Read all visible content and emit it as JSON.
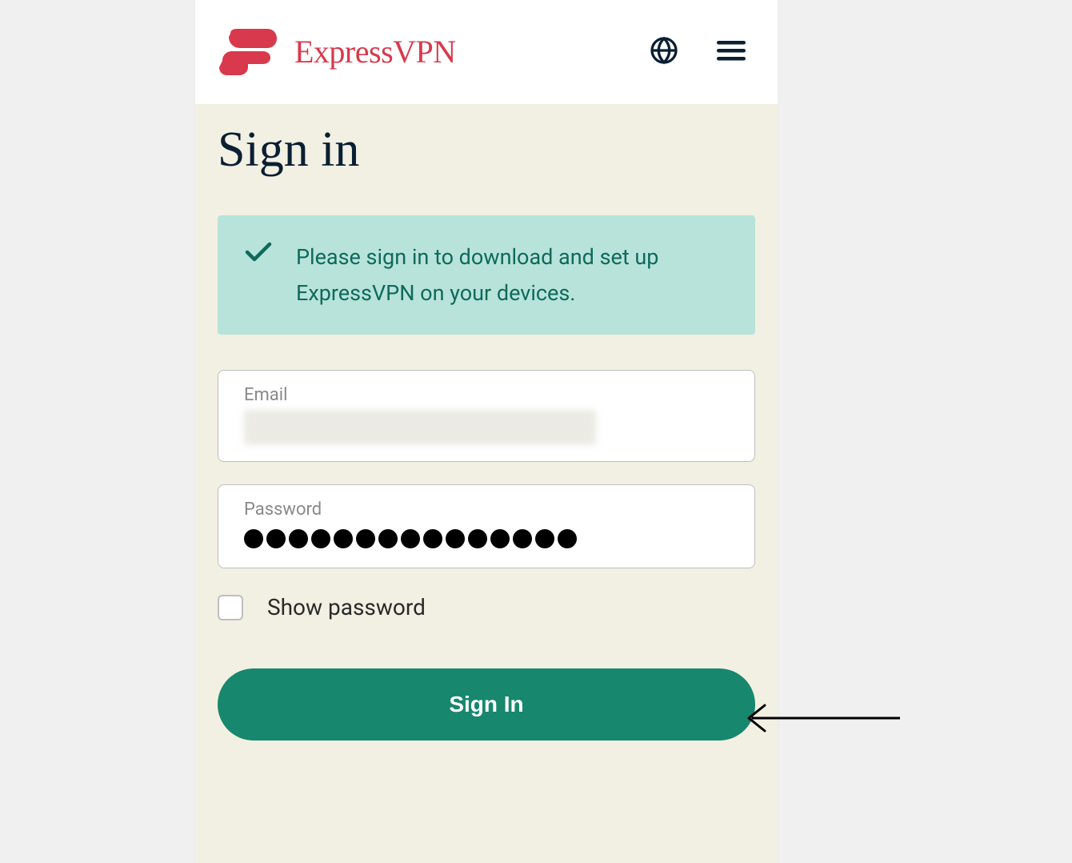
{
  "brand": {
    "name": "ExpressVPN"
  },
  "page": {
    "title": "Sign in",
    "notice_text": "Please sign in to download and set up ExpressVPN on your devices."
  },
  "form": {
    "email_label": "Email",
    "email_value": "",
    "password_label": "Password",
    "password_dot_count": 15,
    "show_password_label": "Show password",
    "show_password_checked": false,
    "submit_label": "Sign In"
  },
  "colors": {
    "brand_red": "#d9394c",
    "accent_green": "#17876e",
    "notice_bg": "#b8e3db",
    "notice_text": "#0f6a5b",
    "content_bg": "#f2f0e2",
    "dark_navy": "#0b1f33"
  }
}
